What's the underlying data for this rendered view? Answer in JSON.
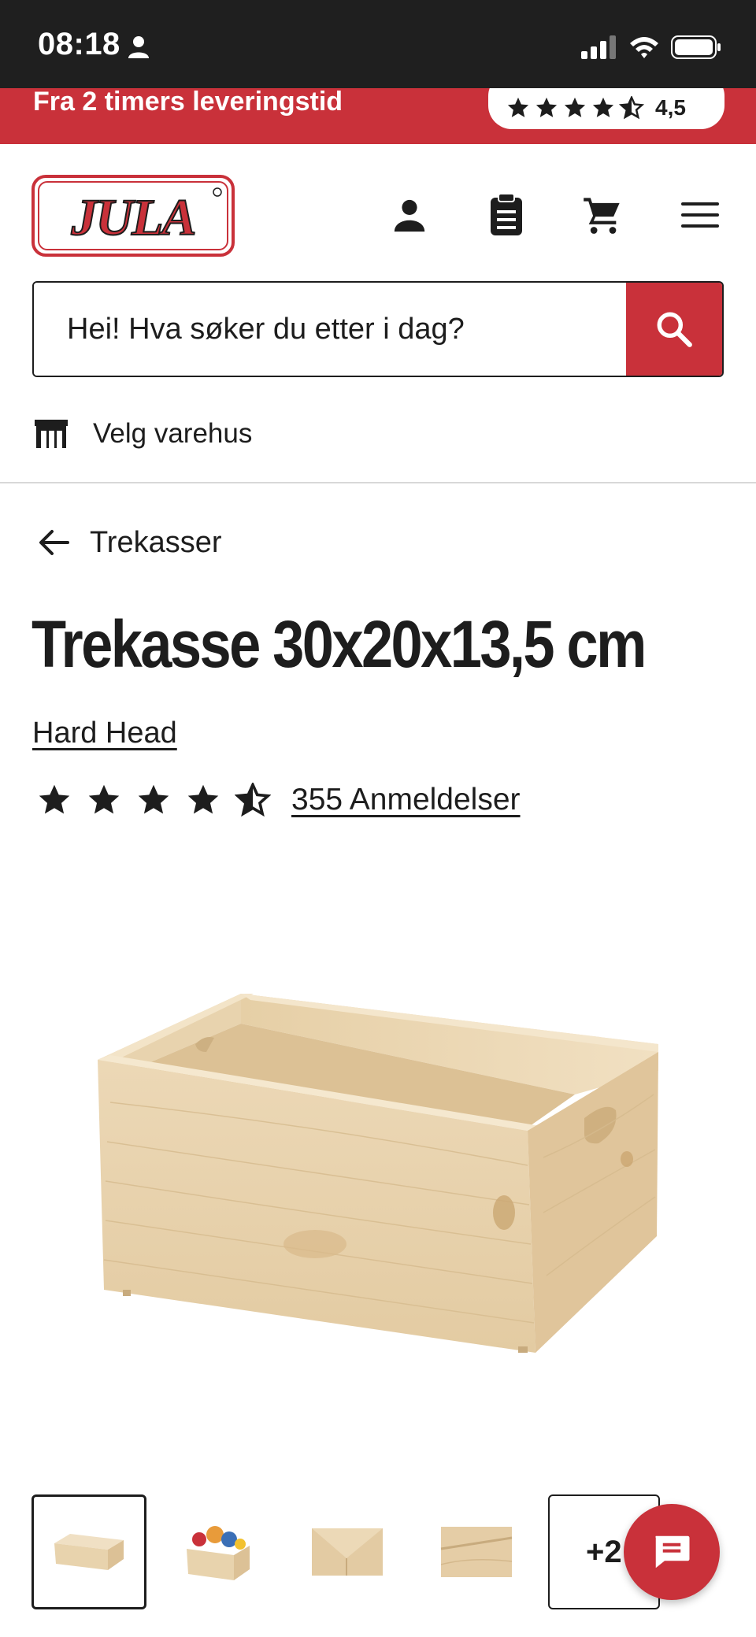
{
  "status_bar": {
    "time": "08:18"
  },
  "promo": {
    "text": "Fra 2 timers leveringstid",
    "rating_score": "4,5"
  },
  "header": {
    "logo_text": "JULA",
    "icons": [
      "person-icon",
      "clipboard-icon",
      "cart-icon",
      "menu-icon"
    ]
  },
  "search": {
    "placeholder": "Hei! Hva søker du etter i dag?"
  },
  "store": {
    "label": "Velg varehus"
  },
  "breadcrumb": {
    "label": "Trekasser"
  },
  "product": {
    "title": "Trekasse 30x20x13,5 cm",
    "brand": "Hard Head",
    "rating": 4.5,
    "rating_max": 5,
    "reviews_label": "355 Anmeldelser"
  },
  "thumbnails": {
    "count_visible": 4,
    "more_label": "+2"
  },
  "colors": {
    "brand_red": "#c9313a",
    "text": "#1d1d1d"
  }
}
